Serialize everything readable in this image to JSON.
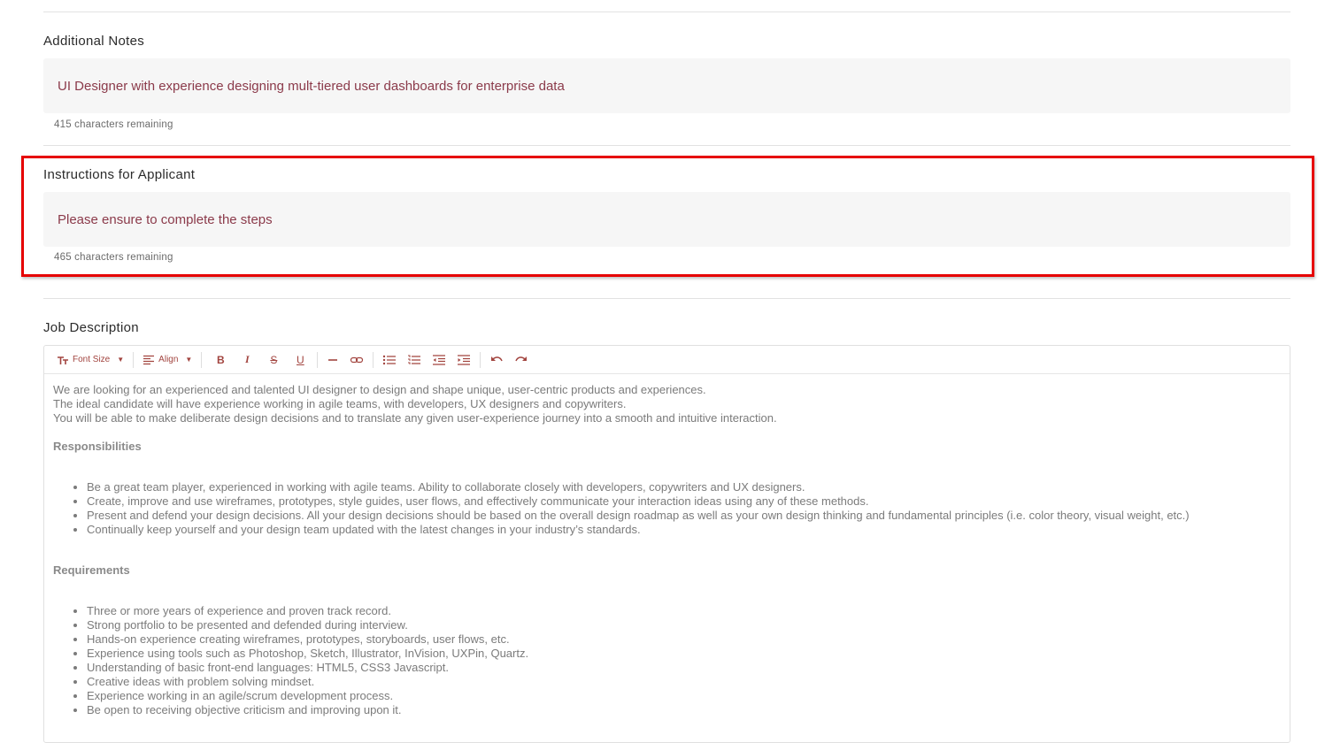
{
  "additional_notes": {
    "label": "Additional Notes",
    "value": "UI Designer with experience designing mult-tiered user dashboards for enterprise data",
    "remaining": "415 characters remaining"
  },
  "instructions": {
    "label": "Instructions for Applicant",
    "value": "Please ensure to complete the steps",
    "remaining": "465 characters remaining"
  },
  "job_description": {
    "label": "Job Description",
    "toolbar": {
      "font_size_label": "Font Size",
      "align_label": "Align",
      "accent_color": "#a2443f"
    },
    "intro": [
      "We are looking for an experienced and talented UI designer to design and shape unique, user-centric products and experiences.",
      "The ideal candidate will have experience working in agile teams, with developers, UX designers and copywriters.",
      "You will be able to make deliberate design decisions and to translate any given user-experience journey into a smooth and intuitive interaction."
    ],
    "responsibilities_heading": "Responsibilities",
    "responsibilities": [
      "Be a great team player, experienced in working with agile teams. Ability to collaborate closely with developers, copywriters and UX designers.",
      "Create, improve and use wireframes, prototypes, style guides, user flows, and effectively communicate your interaction ideas using any of these methods.",
      "Present and defend your design decisions. All your design decisions should be based on the overall design roadmap as well as your own design thinking and fundamental principles (i.e. color theory, visual weight, etc.)",
      "Continually keep yourself and your design team updated with the latest changes in your industry’s standards."
    ],
    "requirements_heading": "Requirements",
    "requirements": [
      "Three or more years of experience and proven track record.",
      "Strong portfolio to be presented and defended during interview.",
      "Hands-on experience creating wireframes, prototypes, storyboards, user flows, etc.",
      "Experience using tools such as Photoshop, Sketch, Illustrator, InVision, UXPin, Quartz.",
      "Understanding of basic front-end languages: HTML5, CSS3 Javascript.",
      "Creative ideas with problem solving mindset.",
      "Experience working in an agile/scrum development process.",
      "Be open to receiving objective criticism and improving upon it."
    ]
  },
  "colors": {
    "field_text": "#8b3a4a",
    "highlight_border": "#e60000",
    "field_background": "#f6f6f6"
  }
}
